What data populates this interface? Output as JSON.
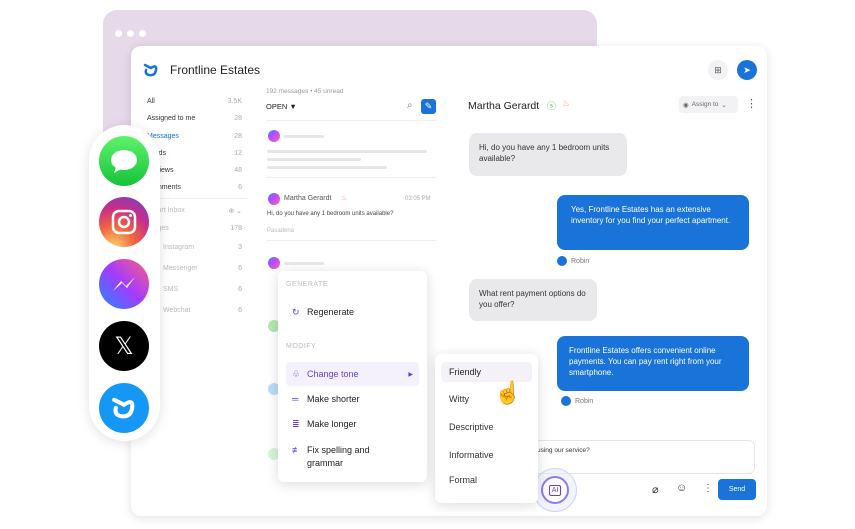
{
  "app": {
    "title": "Frontline Estates"
  },
  "sidebar": {
    "items": [
      {
        "label": "All",
        "count": "3.5K"
      },
      {
        "label": "Assigned to me",
        "count": "28"
      },
      {
        "label": "Messages",
        "count": "28"
      },
      {
        "label": "Leads",
        "count": "12"
      },
      {
        "label": "Reviews",
        "count": "48"
      },
      {
        "label": "Comments",
        "count": "6"
      }
    ],
    "smart_inbox": "Smart Inbox",
    "sub_items": [
      {
        "label": "Stages",
        "count": "178"
      },
      {
        "label": "Instagram",
        "count": "3"
      },
      {
        "label": "Messenger",
        "count": "6"
      },
      {
        "label": "SMS",
        "count": "6"
      },
      {
        "label": "Webchat",
        "count": "6"
      }
    ]
  },
  "list": {
    "summary": "192 messages • 45 unread",
    "filter": "OPEN ▼",
    "item": {
      "name": "Martha Gerardt",
      "time": "03:05 PM",
      "preview": "Hi, do you have any 1 bedroom units available?",
      "location": "Pasadena"
    }
  },
  "chat": {
    "contact": "Martha Gerardt",
    "assign_label": "Assign to",
    "messages": [
      {
        "from": "contact",
        "text": "Hi, do you have any 1 bedroom units available?"
      },
      {
        "from": "agent",
        "text": "Yes, Frontline Estates has an extensive inventory for you find your perfect apartment.",
        "sender": "Robin"
      },
      {
        "from": "contact",
        "text": "What rent payment options do you offer?"
      },
      {
        "from": "agent",
        "text": "Frontline Estates offers convenient online payments. You can pay rent right from your smartphone.",
        "sender": "Robin"
      }
    ],
    "input_value": "using our service?",
    "send_label": "Send",
    "ai_label": "AI"
  },
  "ai_menu": {
    "generate_header": "GENERATE",
    "regenerate": "Regenerate",
    "modify_header": "MODIFY",
    "items": [
      "Change tone",
      "Make shorter",
      "Make longer",
      "Fix spelling and grammar"
    ]
  },
  "tone_menu": {
    "options": [
      "Friendly",
      "Witty",
      "Descriptive",
      "Informative",
      "Formal"
    ],
    "selected": "Friendly"
  },
  "channels": [
    "imessage-icon",
    "instagram-icon",
    "messenger-icon",
    "x-icon",
    "frontline-icon"
  ],
  "colors": {
    "accent": "#1a73d9",
    "ai_purple": "#6a3fd1",
    "window_bg": "#e6d9e9"
  }
}
